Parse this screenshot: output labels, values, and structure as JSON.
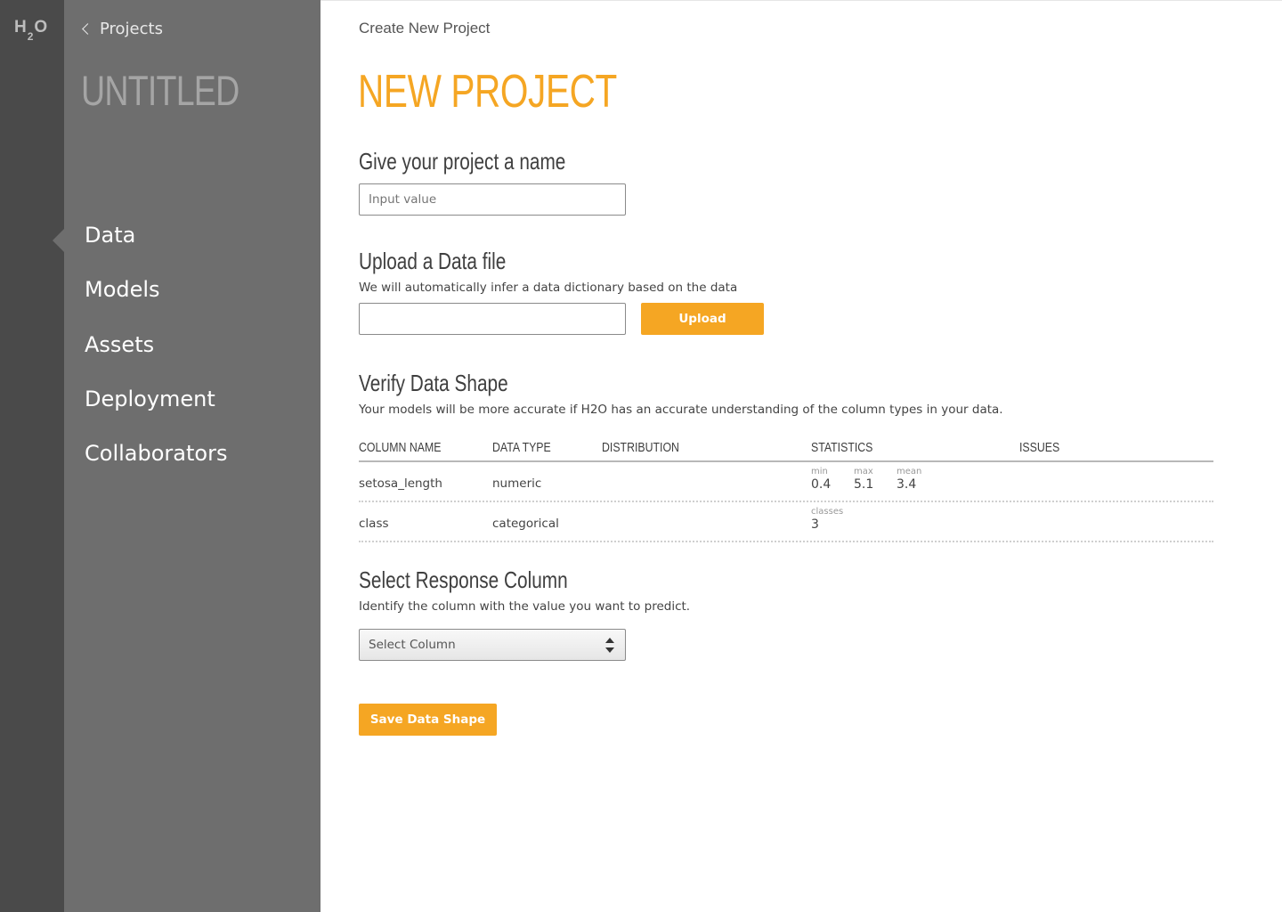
{
  "brand": {
    "logo_h": "H",
    "logo_sub": "2",
    "logo_o": "O"
  },
  "sidebar": {
    "back_label": "Projects",
    "project_title": "UNTITLED",
    "items": [
      {
        "label": "Data",
        "active": true
      },
      {
        "label": "Models"
      },
      {
        "label": "Assets"
      },
      {
        "label": "Deployment"
      },
      {
        "label": "Collaborators"
      }
    ]
  },
  "main": {
    "breadcrumb": "Create New Project",
    "title": "NEW PROJECT",
    "name_section": {
      "heading": "Give your project a name",
      "placeholder": "Input value"
    },
    "upload_section": {
      "heading": "Upload a Data file",
      "description": "We will automatically infer a data dictionary based on the data",
      "input_value": "",
      "button_label": "Upload"
    },
    "verify_section": {
      "heading": "Verify Data Shape",
      "description": "Your models will be more accurate if H2O has an accurate understanding of the column types in your data.",
      "columns": [
        "COLUMN NAME",
        "DATA TYPE",
        "DISTRIBUTION",
        "STATISTICS",
        "ISSUES"
      ],
      "rows": [
        {
          "name": "setosa_length",
          "type": "numeric",
          "stats": [
            {
              "label": "min",
              "value": "0.4"
            },
            {
              "label": "max",
              "value": "5.1"
            },
            {
              "label": "mean",
              "value": "3.4"
            }
          ]
        },
        {
          "name": "class",
          "type": "categorical",
          "stats": [
            {
              "label": "classes",
              "value": "3"
            }
          ]
        }
      ]
    },
    "response_section": {
      "heading": "Select Response Column",
      "description": "Identify the column with the value you want to predict.",
      "select_value": "Select Column"
    },
    "save_button_label": "Save Data Shape"
  },
  "colors": {
    "accent": "#f5a623",
    "rail": "#4a4a4a",
    "sidebar": "#6e6e6e"
  }
}
